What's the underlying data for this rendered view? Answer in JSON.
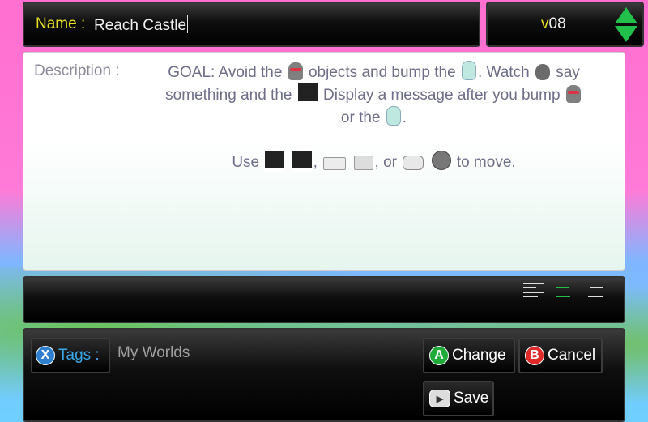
{
  "name_field": {
    "label": "Name :",
    "value": "Reach Castle"
  },
  "version": {
    "prefix": "v",
    "number": "08"
  },
  "description": {
    "label": "Description :",
    "line1_a": "GOAL: Avoid the",
    "line1_b": "objects and bump the",
    "line1_c": ". Watch",
    "line1_d": "say",
    "line2_a": "something and the",
    "line2_b": "Display a message after you bump",
    "line3_a": "or the",
    "line3_b": ".",
    "move_a": "Use",
    "move_b": ",",
    "move_c": ", or",
    "move_d": "to move."
  },
  "tags": {
    "button_label": "Tags :",
    "button_glyph": "X",
    "value": "My Worlds"
  },
  "actions": {
    "change_label": "Change",
    "change_glyph": "A",
    "cancel_label": "Cancel",
    "cancel_glyph": "B",
    "save_label": "Save"
  },
  "colors": {
    "accent_green": "#22c04a",
    "label_yellow": "#e8e020",
    "tag_blue": "#3aa7e6"
  }
}
